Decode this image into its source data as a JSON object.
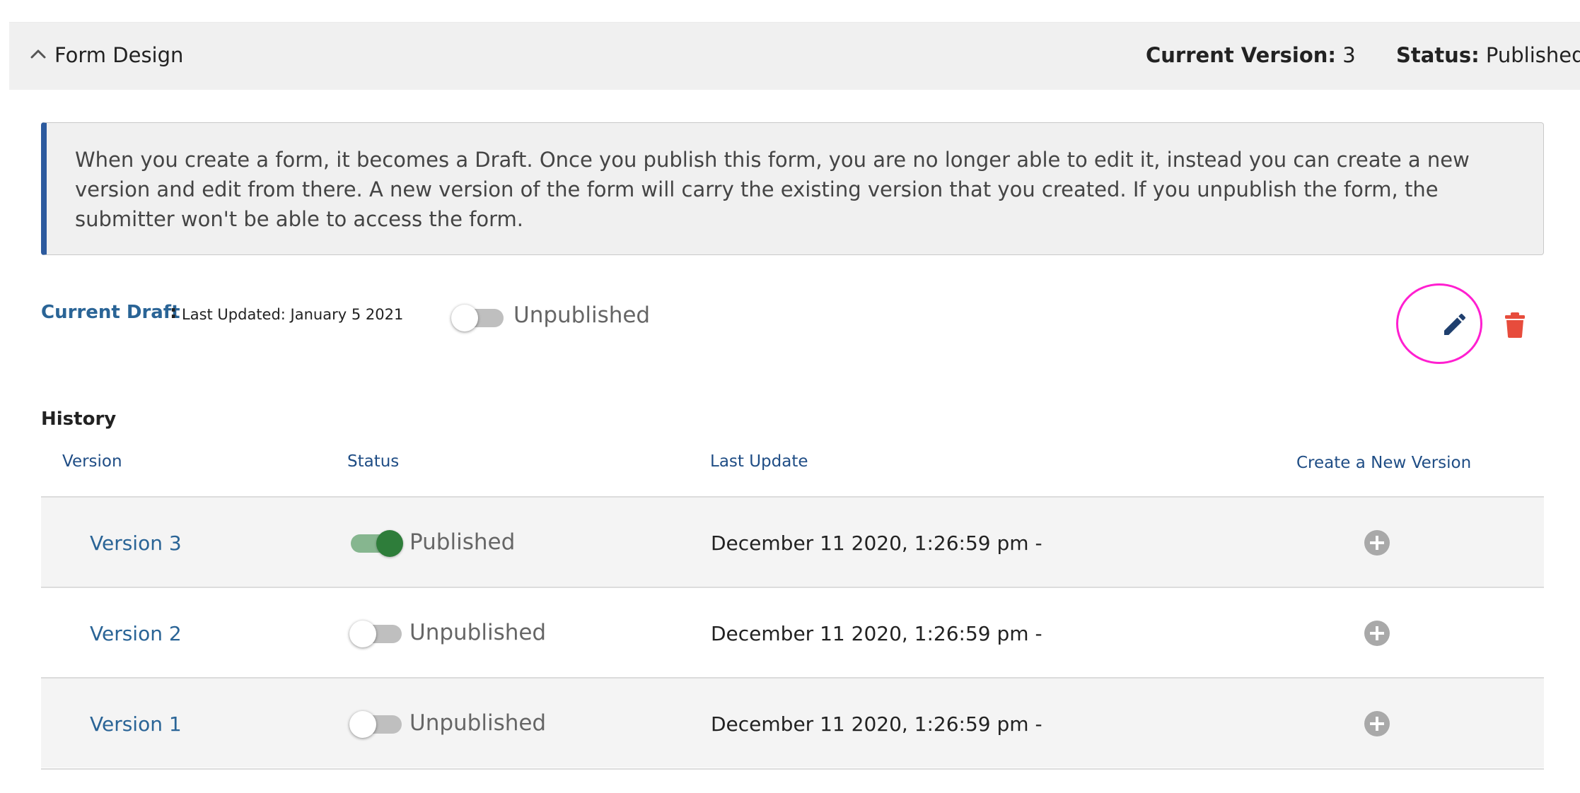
{
  "header": {
    "title": "Form Design",
    "current_version_label": "Current Version:",
    "current_version_value": "3",
    "status_label": "Status:",
    "status_value": "Published"
  },
  "info": {
    "text": "When you create a form, it becomes a Draft. Once you publish this form, you are no longer able to edit it, instead you can create a new version and edit from there. A new version of the form will carry the existing version that you created. If you unpublish the form, the submitter won't be able to access the form."
  },
  "draft": {
    "label": "Current Draft",
    "separator": ":",
    "last_updated": "Last Updated: January 5 2021",
    "status": "Unpublished",
    "published": false
  },
  "history": {
    "title": "History",
    "columns": {
      "version": "Version",
      "status": "Status",
      "last_update": "Last Update",
      "create": "Create a New Version"
    },
    "rows": [
      {
        "version": "Version 3",
        "status": "Published",
        "published": true,
        "last_update": "December 11 2020, 1:26:59 pm -"
      },
      {
        "version": "Version 2",
        "status": "Unpublished",
        "published": false,
        "last_update": "December 11 2020, 1:26:59 pm -"
      },
      {
        "version": "Version 1",
        "status": "Unpublished",
        "published": false,
        "last_update": "December 11 2020, 1:26:59 pm -"
      }
    ]
  },
  "icons": {
    "collapse": "chevron-up-icon",
    "edit": "pencil-icon",
    "delete": "trash-icon",
    "create_version": "plus-circle-icon"
  },
  "colors": {
    "link": "#2a6496",
    "info_accent": "#2c5a9e",
    "published_toggle": "#2e7d3a",
    "delete": "#e74c3c",
    "highlight_circle": "#ff1fd0",
    "header_bg": "#f0f0f0"
  }
}
